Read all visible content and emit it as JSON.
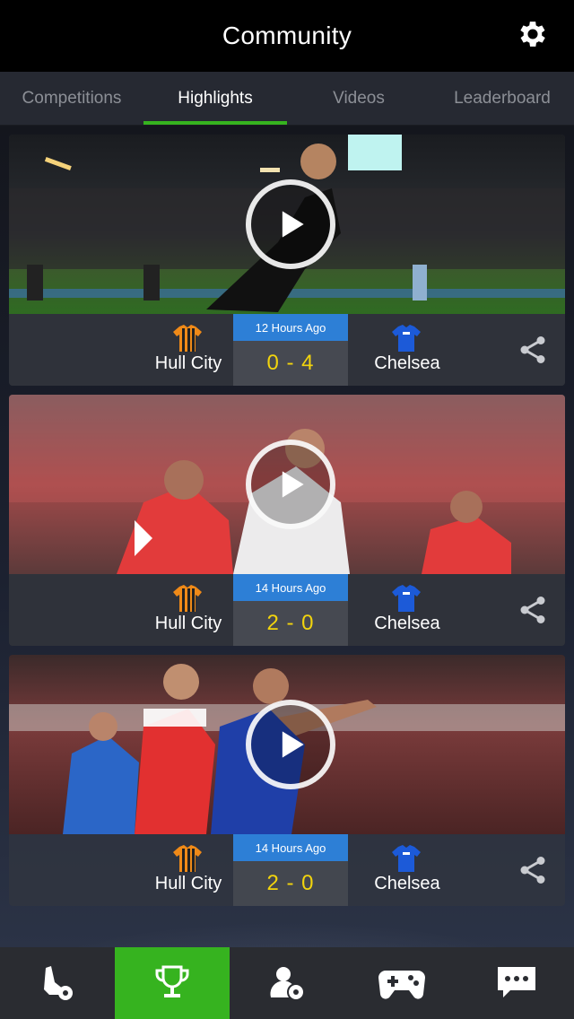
{
  "header": {
    "title": "Community",
    "settings_icon": "gear-icon"
  },
  "tabs": [
    {
      "label": "Competitions",
      "active": false
    },
    {
      "label": "Highlights",
      "active": true
    },
    {
      "label": "Videos",
      "active": false
    },
    {
      "label": "Leaderboard",
      "active": false
    }
  ],
  "highlights": [
    {
      "time": "12 Hours Ago",
      "home": "Hull City",
      "away": "Chelsea",
      "score": "0 - 4"
    },
    {
      "time": "14 Hours Ago",
      "home": "Hull City",
      "away": "Chelsea",
      "score": "2 - 0"
    },
    {
      "time": "14 Hours Ago",
      "home": "Hull City",
      "away": "Chelsea",
      "score": "2 - 0"
    }
  ],
  "bottom_nav": [
    {
      "icon": "football-boot-icon",
      "active": false
    },
    {
      "icon": "trophy-icon",
      "active": true
    },
    {
      "icon": "player-profile-icon",
      "active": false
    },
    {
      "icon": "gamepad-icon",
      "active": false
    },
    {
      "icon": "chat-icon",
      "active": false
    }
  ],
  "colors": {
    "accent_green": "#36b31f",
    "time_badge_blue": "#2d7fd6",
    "score_yellow": "#f2d40d"
  }
}
